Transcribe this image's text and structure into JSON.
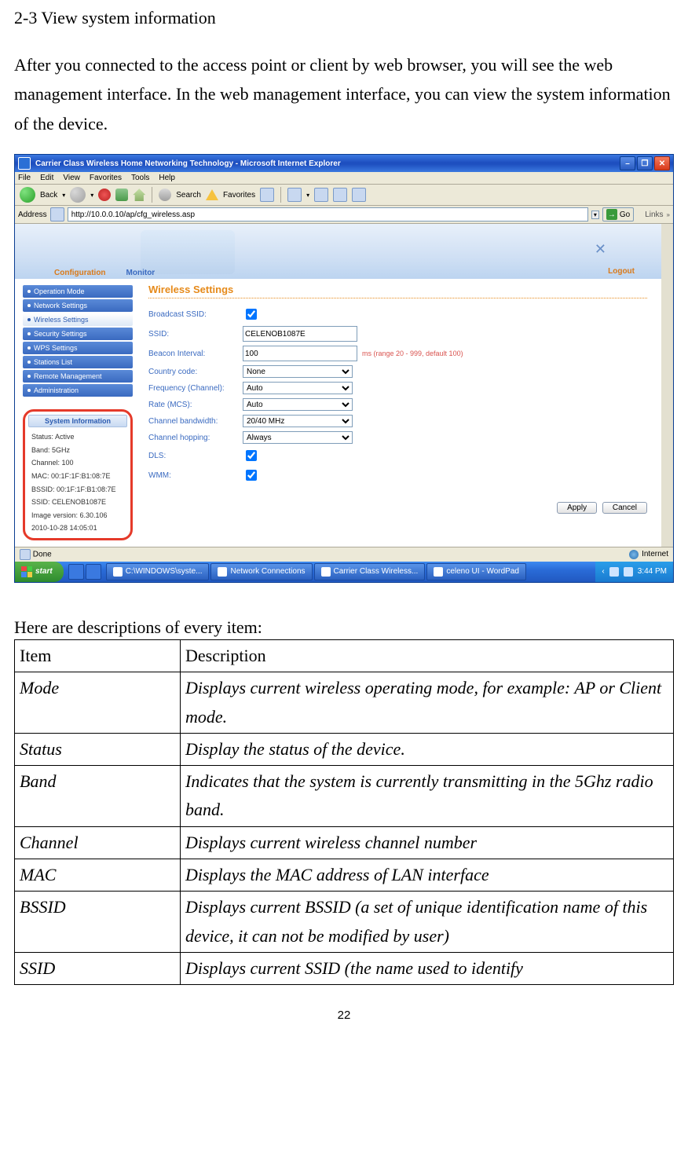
{
  "section_heading": "2-3 View system information",
  "intro": "After you connected to the access point or client by web browser, you will see the web management interface. In the web management interface, you can view the system information of the device.",
  "ie": {
    "title": "Carrier Class Wireless Home Networking Technology - Microsoft Internet Explorer",
    "menu": [
      "File",
      "Edit",
      "View",
      "Favorites",
      "Tools",
      "Help"
    ],
    "back": "Back",
    "search": "Search",
    "favorites": "Favorites",
    "addr_label": "Address",
    "url": "http://10.0.0.10/ap/cfg_wireless.asp",
    "go": "Go",
    "links": "Links",
    "status_done": "Done",
    "status_internet": "Internet"
  },
  "webui": {
    "tabs": {
      "config": "Configuration",
      "monitor": "Monitor"
    },
    "logout": "Logout",
    "side": {
      "op": "Operation Mode",
      "net": "Network Settings",
      "wifi": "Wireless Settings",
      "sec": "Security Settings",
      "wps": "WPS Settings",
      "sta": "Stations List",
      "rm": "Remote Management",
      "adm": "Administration"
    },
    "sysinfo": {
      "title": "System Information",
      "status": "Status: Active",
      "band": "Band: 5GHz",
      "channel": "Channel: 100",
      "mac": "MAC: 00:1F:1F:B1:08:7E",
      "bssid": "BSSID: 00:1F:1F:B1:08:7E",
      "ssid": "SSID: CELENOB1087E",
      "image": "Image version: 6.30.106",
      "date": "2010-10-28 14:05:01"
    },
    "panel_title": "Wireless Settings",
    "form": {
      "bcast_lbl": "Broadcast SSID:",
      "ssid_lbl": "SSID:",
      "ssid_val": "CELENOB1087E",
      "bi_lbl": "Beacon Interval:",
      "bi_val": "100",
      "bi_hint": "ms (range 20 - 999, default 100)",
      "cc_lbl": "Country code:",
      "cc_val": "None",
      "freq_lbl": "Frequency (Channel):",
      "freq_val": "Auto",
      "rate_lbl": "Rate (MCS):",
      "rate_val": "Auto",
      "cbw_lbl": "Channel bandwidth:",
      "cbw_val": "20/40 MHz",
      "hop_lbl": "Channel hopping:",
      "hop_val": "Always",
      "dls_lbl": "DLS:",
      "wmm_lbl": "WMM:"
    },
    "apply": "Apply",
    "cancel": "Cancel"
  },
  "taskbar": {
    "start": "start",
    "t1": "C:\\WINDOWS\\syste...",
    "t2": "Network Connections",
    "t3": "Carrier Class Wireless...",
    "t4": "celeno UI - WordPad",
    "time": "3:44 PM"
  },
  "desc_heading": "Here are descriptions of every item:",
  "table": {
    "h1": "Item",
    "h2": "Description",
    "r1a": "Mode",
    "r1b": "Displays current wireless operating mode, for example: AP or Client mode.",
    "r2a": "Status",
    "r2b": "Display the status of the device.",
    "r3a": "Band",
    "r3b": "Indicates that the system is currently transmitting in the 5Ghz radio band.",
    "r4a": "Channel",
    "r4b": "Displays current wireless channel number",
    "r5a": "MAC",
    "r5b": "Displays the MAC address of LAN interface",
    "r6a": "BSSID",
    "r6b": "Displays current BSSID (a set of unique identification name of this device, it can not be modified by user)",
    "r7a": "SSID",
    "r7b": "Displays current SSID (the name used to identify"
  },
  "page_num": "22"
}
